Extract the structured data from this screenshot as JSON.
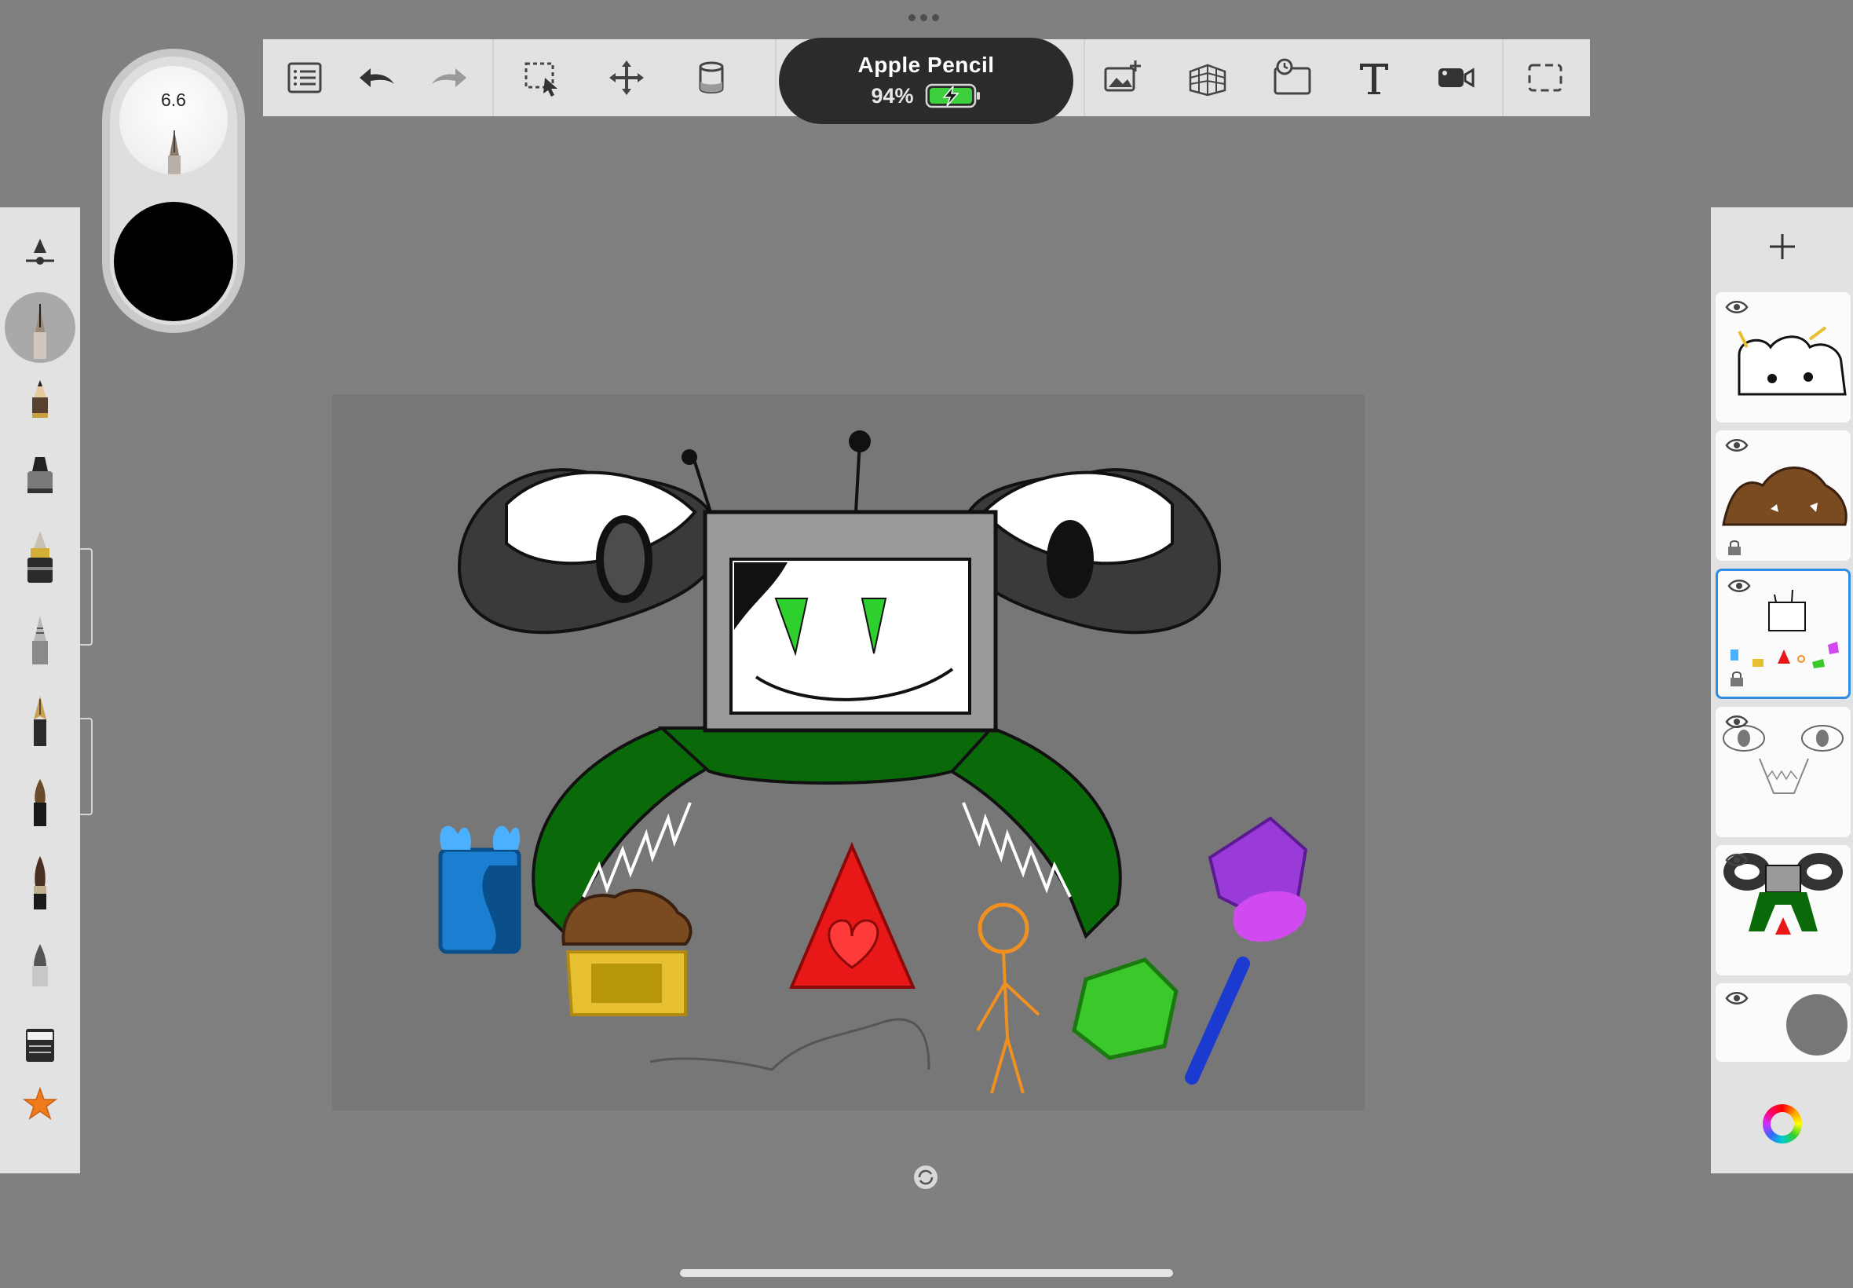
{
  "pencil": {
    "name": "Apple Pencil",
    "battery": "94%"
  },
  "brush": {
    "size": "6.6",
    "color": "#000000"
  },
  "toolbar": {
    "icons": [
      "gallery-list-icon",
      "undo-icon",
      "redo-icon",
      "selection-icon",
      "transform-icon",
      "fill-bucket-icon",
      "insert-image-icon",
      "perspective-guide-icon",
      "time-lapse-icon",
      "text-icon",
      "record-icon",
      "fullscreen-icon"
    ]
  },
  "brushes": [
    "brush-settings",
    "technical-pen",
    "pencil",
    "felt-marker",
    "ink-pen",
    "ballpoint-pen",
    "fountain-pen",
    "paint-brush",
    "ink-brush",
    "airbrush",
    "eraser",
    "favorites"
  ],
  "layers": {
    "add_label": "+",
    "items": [
      {
        "name": "layer-antennae",
        "visible": true,
        "locked": false,
        "selected": false
      },
      {
        "name": "layer-brown-hat",
        "visible": true,
        "locked": true,
        "selected": false
      },
      {
        "name": "layer-characters",
        "visible": true,
        "locked": true,
        "selected": true
      },
      {
        "name": "layer-sketch",
        "visible": true,
        "locked": false,
        "selected": false
      },
      {
        "name": "layer-color-composite",
        "visible": true,
        "locked": false,
        "selected": false
      },
      {
        "name": "layer-background",
        "visible": true,
        "locked": false,
        "selected": false
      }
    ],
    "background_color": "#777777"
  },
  "colors": {
    "canvas_bg": "#777777",
    "app_bg": "#808080",
    "panel": "#e2e2e2",
    "accent": "#2f8de4",
    "battery": "#3ecf3e"
  }
}
